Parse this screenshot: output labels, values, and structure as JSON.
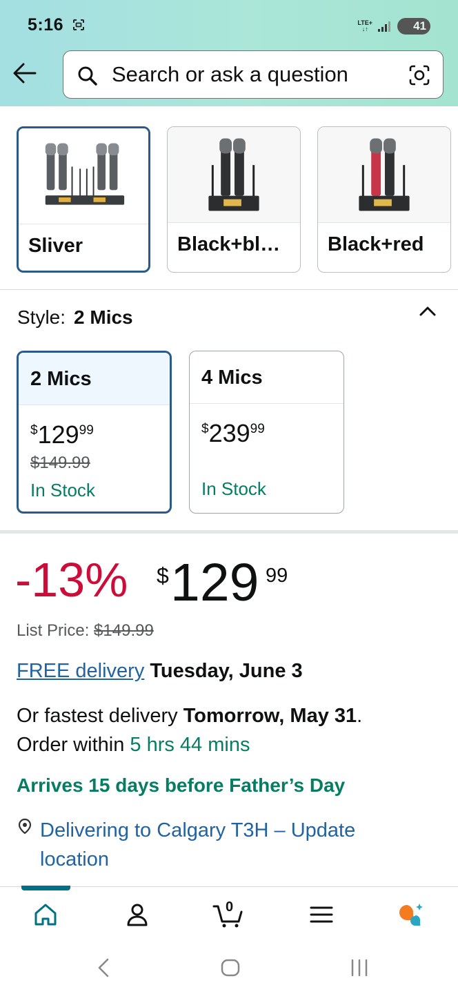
{
  "status_bar": {
    "time": "5:16",
    "network": "LTE+",
    "battery": "41"
  },
  "search": {
    "placeholder": "Search or ask a question"
  },
  "colors": {
    "accent_blue": "#2b5a8a",
    "link_blue": "#2162a1",
    "discount_red": "#cc0c39",
    "stock_green": "#067d62",
    "nav_teal": "#007185"
  },
  "color_options": [
    {
      "label": "Sliver",
      "selected": true
    },
    {
      "label": "Black+bl…",
      "selected": false
    },
    {
      "label": "Black+red",
      "selected": false
    }
  ],
  "style_selector": {
    "label": "Style:",
    "selected_value": "2 Mics",
    "options": [
      {
        "name": "2 Mics",
        "price_symbol": "$",
        "price_whole": "129",
        "price_cents": "99",
        "list_price": "$149.99",
        "stock": "In Stock",
        "selected": true
      },
      {
        "name": "4 Mics",
        "price_symbol": "$",
        "price_whole": "239",
        "price_cents": "99",
        "list_price": "",
        "stock": "In Stock",
        "selected": false
      }
    ]
  },
  "price": {
    "discount": "-13%",
    "symbol": "$",
    "whole": "129",
    "cents": "99",
    "list_price_label": "List Price:",
    "list_price": "$149.99"
  },
  "delivery": {
    "free_link": "FREE delivery",
    "free_date": "Tuesday, June 3",
    "fastest_prefix": "Or fastest delivery",
    "fastest_date": "Tomorrow, May 31",
    "fastest_suffix": ".",
    "order_prefix": "Order within",
    "order_countdown": "5 hrs 44 mins",
    "arrives_note": "Arrives 15 days before Father’s Day",
    "location": "Delivering to Calgary T3H – Update location"
  },
  "bottom_nav": {
    "cart_count": "0",
    "items": [
      "home-icon",
      "account-icon",
      "cart-icon",
      "menu-icon",
      "rufus-assistant-icon"
    ]
  }
}
